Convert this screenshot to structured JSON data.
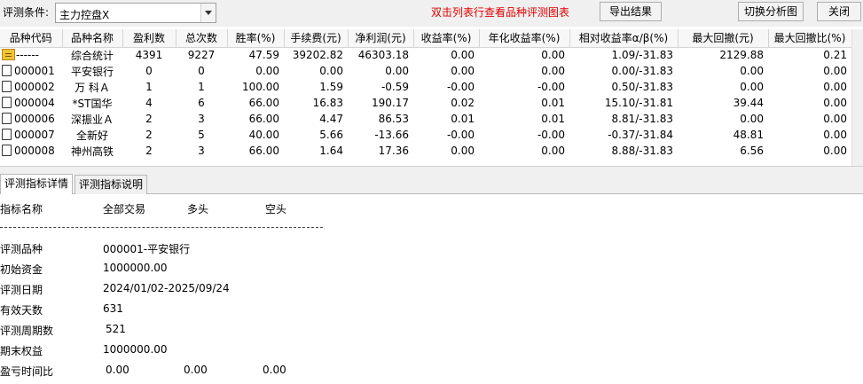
{
  "toolbar": {
    "condition_label": "评测条件:",
    "condition_value": "主力控盘X",
    "hint": "双击列表行查看品种评测图表",
    "export_label": "导出结果",
    "switch_label": "切换分析图",
    "close_label": "关闭"
  },
  "table": {
    "columns": [
      "品种代码",
      "品种名称",
      "盈利数",
      "总次数",
      "胜率(%)",
      "手续费(元)",
      "净利润(元)",
      "收益率(%)",
      "年化收益率(%)",
      "相对收益率α/β(%)",
      "最大回撤(元)",
      "最大回撤比(%)"
    ],
    "summary": {
      "code": "------",
      "name": "综合统计",
      "profit_count": "4391",
      "total_count": "9227",
      "win_rate": "47.59",
      "fee": "39202.82",
      "net_profit": "46303.18",
      "return": "0.00",
      "annual_return": "0.00",
      "relative": "1.09/-31.83",
      "max_dd": "2129.88",
      "max_dd_ratio": "0.21"
    },
    "rows": [
      {
        "code": "000001",
        "name": "平安银行",
        "profit_count": "0",
        "total_count": "0",
        "win_rate": "0.00",
        "fee": "0.00",
        "net_profit": "0.00",
        "return": "0.00",
        "annual_return": "0.00",
        "relative": "0.00/-31.83",
        "max_dd": "0.00",
        "max_dd_ratio": "0.00"
      },
      {
        "code": "000002",
        "name": "万 科Ａ",
        "profit_count": "1",
        "total_count": "1",
        "win_rate": "100.00",
        "fee": "1.59",
        "net_profit": "-0.59",
        "return": "-0.00",
        "annual_return": "-0.00",
        "relative": "0.50/-31.83",
        "max_dd": "0.00",
        "max_dd_ratio": "0.00"
      },
      {
        "code": "000004",
        "name": "*ST国华",
        "profit_count": "4",
        "total_count": "6",
        "win_rate": "66.00",
        "fee": "16.83",
        "net_profit": "190.17",
        "return": "0.02",
        "annual_return": "0.01",
        "relative": "15.10/-31.81",
        "max_dd": "39.44",
        "max_dd_ratio": "0.00"
      },
      {
        "code": "000006",
        "name": "深振业Ａ",
        "profit_count": "2",
        "total_count": "3",
        "win_rate": "66.00",
        "fee": "4.47",
        "net_profit": "86.53",
        "return": "0.01",
        "annual_return": "0.01",
        "relative": "8.81/-31.83",
        "max_dd": "0.00",
        "max_dd_ratio": "0.00"
      },
      {
        "code": "000007",
        "name": "全新好",
        "profit_count": "2",
        "total_count": "5",
        "win_rate": "40.00",
        "fee": "5.66",
        "net_profit": "-13.66",
        "return": "-0.00",
        "annual_return": "-0.00",
        "relative": "-0.37/-31.84",
        "max_dd": "48.81",
        "max_dd_ratio": "0.00"
      },
      {
        "code": "000008",
        "name": "神州高铁",
        "profit_count": "2",
        "total_count": "3",
        "win_rate": "66.00",
        "fee": "1.64",
        "net_profit": "17.36",
        "return": "0.00",
        "annual_return": "0.00",
        "relative": "8.88/-31.83",
        "max_dd": "6.56",
        "max_dd_ratio": "0.00"
      }
    ]
  },
  "tabs": [
    "评测指标详情",
    "评测指标说明"
  ],
  "detail": {
    "header": {
      "name": "指标名称",
      "all": "全部交易",
      "long": "多头",
      "short": "空头"
    },
    "separator": "------------------------------------------------------------",
    "items": [
      {
        "label": "评测品种",
        "value": "000001-平安银行"
      },
      {
        "label": "初始资金",
        "value": "1000000.00"
      },
      {
        "label": "评测日期",
        "value": "2024/01/02-2025/09/24"
      },
      {
        "label": "有效天数",
        "value": "631"
      },
      {
        "label": "评测周期数",
        "value": "521"
      },
      {
        "label": "期末权益",
        "value": "1000000.00"
      }
    ],
    "ratio": {
      "label": "盈亏时间比",
      "all": "0.00",
      "long": "0.00",
      "short": "0.00"
    }
  },
  "icons": {
    "dropdown": "chevron-down-icon",
    "row": "document-icon",
    "summary": "folder-icon"
  }
}
